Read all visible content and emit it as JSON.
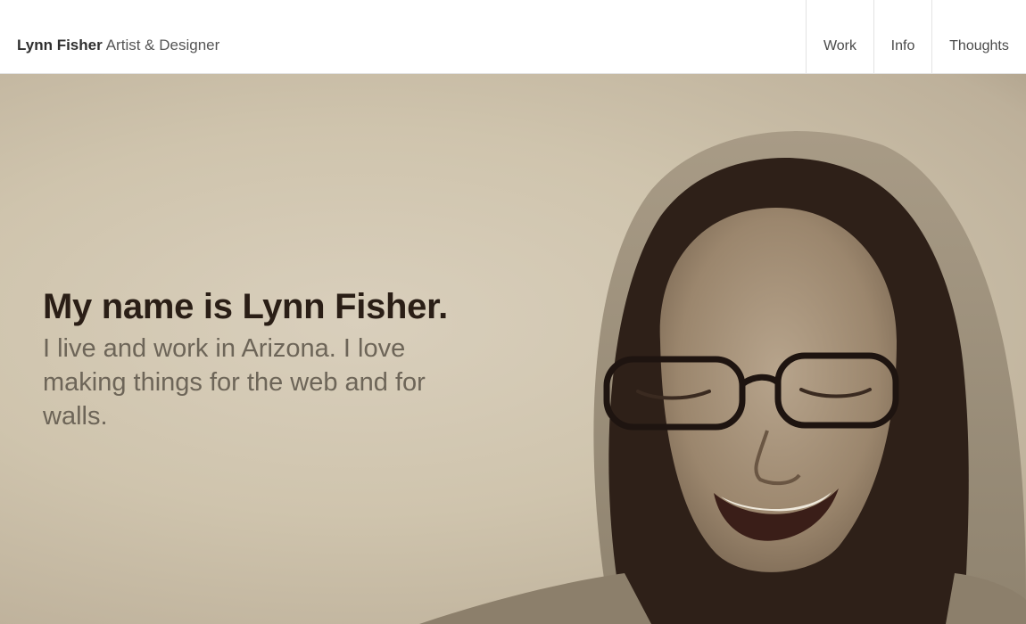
{
  "header": {
    "brand_name": "Lynn Fisher",
    "brand_tagline": "Artist & Designer",
    "nav": [
      {
        "label": "Work"
      },
      {
        "label": "Info"
      },
      {
        "label": "Thoughts"
      }
    ]
  },
  "hero": {
    "title": "My name is Lynn Fisher.",
    "body": "I live and work in Arizona. I love making things for the web and for walls.",
    "image": "portrait-photo"
  },
  "colors": {
    "hero_background": "#cfc4ad",
    "title_text": "#2a1e16",
    "body_text": "#6d6558",
    "header_border": "#e3e3e3"
  }
}
